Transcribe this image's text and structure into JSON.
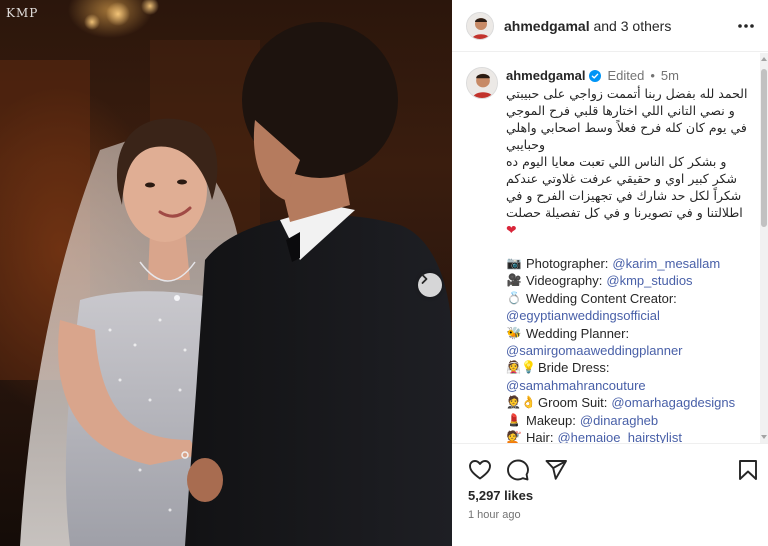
{
  "photo": {
    "watermark": "KMP",
    "next_icon": "chevron-right-icon"
  },
  "header": {
    "username": "ahmedgamal",
    "collab_text": "and 3 others",
    "more_icon": "more-horizontal-icon"
  },
  "caption": {
    "username": "ahmedgamal",
    "verified_icon": "verified-badge-icon",
    "edited": "Edited",
    "separator": "•",
    "time": "5m",
    "paragraph_1": "الحمد لله بفضل ربنا أتممت زواجي على حبيبتي و نصي التاني اللي اختارها قلبي فرح الموجي في يوم كان كله فرح فعلاً وسط اصحابي واهلي وحبايبي",
    "paragraph_2": "و بشكر كل الناس اللي تعبت معايا اليوم ده شكر كبير اوي و حقيقي عرفت غلاوتي عندكم شكراً لكل حد شارك في تجهيزات الفرح و في اطلالتنا و في تصويرنا و في كل تفصيلة حصلت",
    "heart_emoji": "❤"
  },
  "credits": [
    {
      "emoji": "📷",
      "label": "Photographer:",
      "handle": "@karim_mesallam",
      "inline": true
    },
    {
      "emoji": "🎥",
      "label": "Videography:",
      "handle": "@kmp_studios",
      "inline": true
    },
    {
      "emoji": "💍",
      "label": "Wedding Content Creator:",
      "handle": "",
      "inline": true
    },
    {
      "emoji": "",
      "label": "",
      "handle": "@egyptianweddingsofficial",
      "inline": false
    },
    {
      "emoji": "🐝",
      "label": "Wedding Planner:",
      "handle": "",
      "inline": true
    },
    {
      "emoji": "",
      "label": "",
      "handle": "@samirgomaaweddingplanner",
      "inline": false
    },
    {
      "emoji": "👰💡",
      "label": "Bride Dress:",
      "handle": "",
      "inline": true
    },
    {
      "emoji": "",
      "label": "",
      "handle": "@samahmahrancouture",
      "inline": false
    },
    {
      "emoji": "🤵👌",
      "label": "Groom Suit:",
      "handle": "@omarhagagdesigns",
      "inline": true
    },
    {
      "emoji": "💄",
      "label": "Makeup:",
      "handle": "@dinaragheb",
      "inline": true
    },
    {
      "emoji": "💇",
      "label": "Hair:",
      "handle": "@hemaioe_hairstylist",
      "inline": true
    }
  ],
  "actions": {
    "like_icon": "heart-outline-icon",
    "comment_icon": "comment-icon",
    "share_icon": "send-icon",
    "save_icon": "bookmark-icon"
  },
  "stats": {
    "likes": "5,297 likes",
    "posted": "1 hour ago"
  }
}
